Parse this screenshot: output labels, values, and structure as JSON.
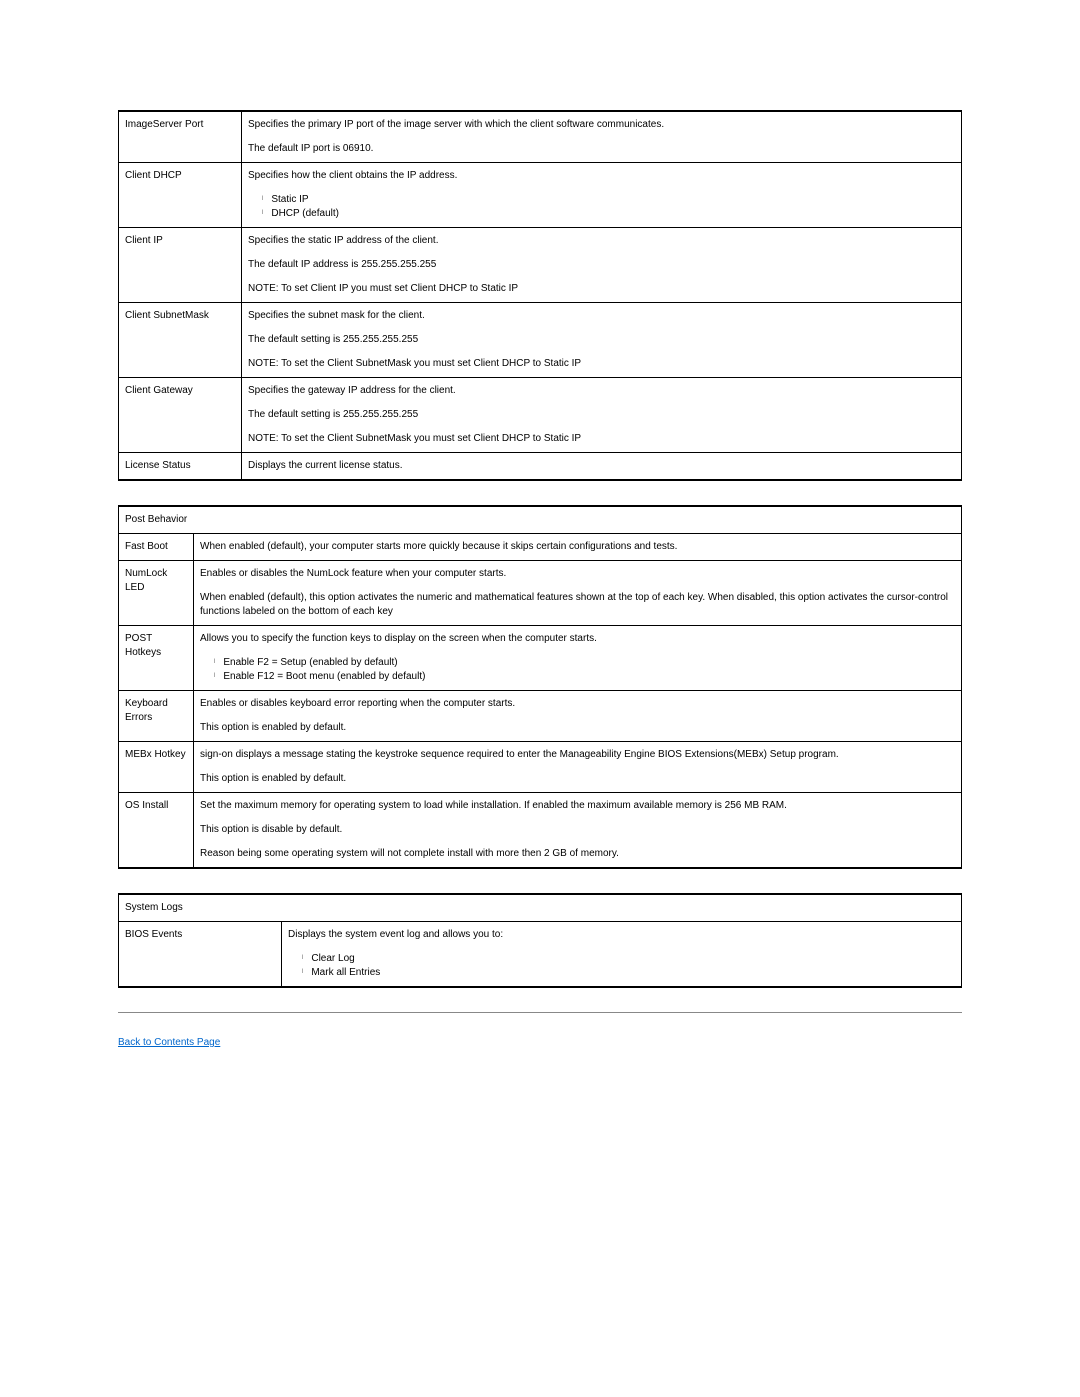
{
  "table1": {
    "rows": [
      {
        "label": "ImageServer Port",
        "paras": [
          "Specifies the primary IP port of the image server with which the client software communicates.",
          "The default IP port is 06910."
        ]
      },
      {
        "label": "Client DHCP",
        "paras": [
          "Specifies how the client obtains the IP address."
        ],
        "bullets": [
          "Static IP",
          "DHCP (default)"
        ]
      },
      {
        "label": "Client IP",
        "paras": [
          "Specifies the static IP address of the client.",
          "The default IP address is 255.255.255.255",
          "NOTE: To set Client IP you must set Client DHCP to Static IP"
        ]
      },
      {
        "label": "Client SubnetMask",
        "paras": [
          "Specifies the subnet mask for the client.",
          "The default setting is 255.255.255.255",
          "NOTE: To set the Client SubnetMask you must set Client DHCP to Static IP"
        ]
      },
      {
        "label": "Client Gateway",
        "paras": [
          "Specifies the gateway IP address for the client.",
          "The default setting is 255.255.255.255",
          "NOTE: To set the Client SubnetMask you must set Client DHCP to Static IP"
        ]
      },
      {
        "label": "License Status",
        "paras": [
          "Displays the current license status."
        ]
      }
    ]
  },
  "table2": {
    "header": "Post Behavior",
    "rows": [
      {
        "label": "Fast Boot",
        "paras": [
          "When enabled (default), your computer starts more quickly because it skips certain configurations and tests."
        ]
      },
      {
        "label": "NumLock LED",
        "paras": [
          "Enables or disables the NumLock feature when your computer starts.",
          "When enabled (default), this option activates the numeric and mathematical features shown at the top of each key. When disabled, this option activates the cursor-control functions labeled on the bottom of each key"
        ]
      },
      {
        "label": "POST Hotkeys",
        "paras": [
          "Allows you to specify the function keys to display on the screen when the computer starts."
        ],
        "bullets": [
          "Enable F2 = Setup (enabled by default)",
          "Enable F12 = Boot menu (enabled by default)"
        ]
      },
      {
        "label": "Keyboard Errors",
        "paras": [
          "Enables or disables keyboard error reporting when the computer starts.",
          "This option is enabled by default."
        ]
      },
      {
        "label": "MEBx Hotkey",
        "paras": [
          "sign-on displays a message stating the keystroke sequence required to enter the Manageability Engine BIOS Extensions(MEBx) Setup program.",
          "This option is enabled by default."
        ]
      },
      {
        "label": "OS Install",
        "paras": [
          "Set the maximum memory for operating system to load while installation. If enabled the maximum available memory is 256 MB RAM.",
          "This option is disable by default.",
          "Reason being some operating system will not complete install with more then 2 GB of memory."
        ]
      }
    ]
  },
  "table3": {
    "header": "System Logs",
    "rows": [
      {
        "label": "BIOS Events",
        "paras": [
          "Displays the system event log and allows you to:"
        ],
        "bullets": [
          "Clear Log",
          "Mark all Entries"
        ]
      }
    ]
  },
  "back_link": "Back to Contents Page"
}
